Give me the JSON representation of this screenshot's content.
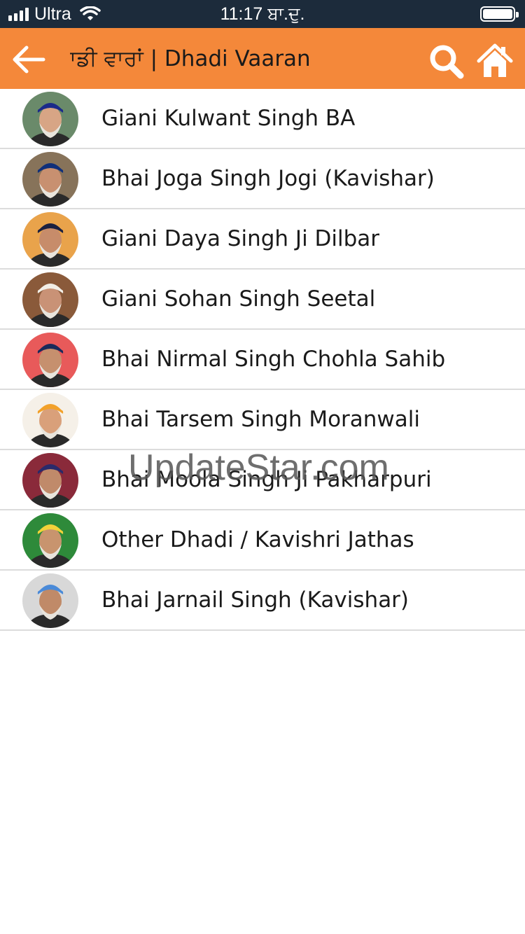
{
  "status_bar": {
    "carrier": "Ultra",
    "time": "11:17 ਬਾ.ਦੁ."
  },
  "header": {
    "title": "ਢਾਡੀ ਵਾਰਾਂ | Dhadi Vaaran",
    "back_icon": "arrow-left-icon",
    "search_icon": "search-icon",
    "home_icon": "home-icon",
    "background": "#f4883a"
  },
  "list": {
    "items": [
      {
        "label": "Giani Kulwant Singh BA",
        "turban": "#1b2a8a",
        "bg": "#6a8a6a",
        "skin": "#d7a585"
      },
      {
        "label": "Bhai Joga Singh Jogi (Kavishar)",
        "turban": "#0f2f7a",
        "bg": "#87735a",
        "skin": "#c89070"
      },
      {
        "label": "Giani Daya Singh Ji Dilbar",
        "turban": "#1b2040",
        "bg": "#e9a34b",
        "skin": "#c78c6a"
      },
      {
        "label": "Giani Sohan Singh Seetal",
        "turban": "#f2eee6",
        "bg": "#8a5a3a",
        "skin": "#c99276"
      },
      {
        "label": "Bhai Nirmal Singh Chohla Sahib",
        "turban": "#1a2a5a",
        "bg": "#e85a5a",
        "skin": "#c6906e"
      },
      {
        "label": "Bhai Tarsem Singh Moranwali",
        "turban": "#f2a12a",
        "bg": "#f5f0e8",
        "skin": "#d9a07a"
      },
      {
        "label": "Bhai Moola Singh Ji Pakharpuri",
        "turban": "#2a2a6a",
        "bg": "#8a2a3a",
        "skin": "#c08a6a"
      },
      {
        "label": "Other Dhadi / Kavishri Jathas",
        "turban": "#f2d23a",
        "bg": "#2e8a3a",
        "skin": "#c8946e"
      },
      {
        "label": "Bhai Jarnail Singh (Kavishar)",
        "turban": "#4a8ad8",
        "bg": "#d8d8d8",
        "skin": "#c08a68"
      }
    ]
  },
  "watermark": "UpdateStar.com"
}
